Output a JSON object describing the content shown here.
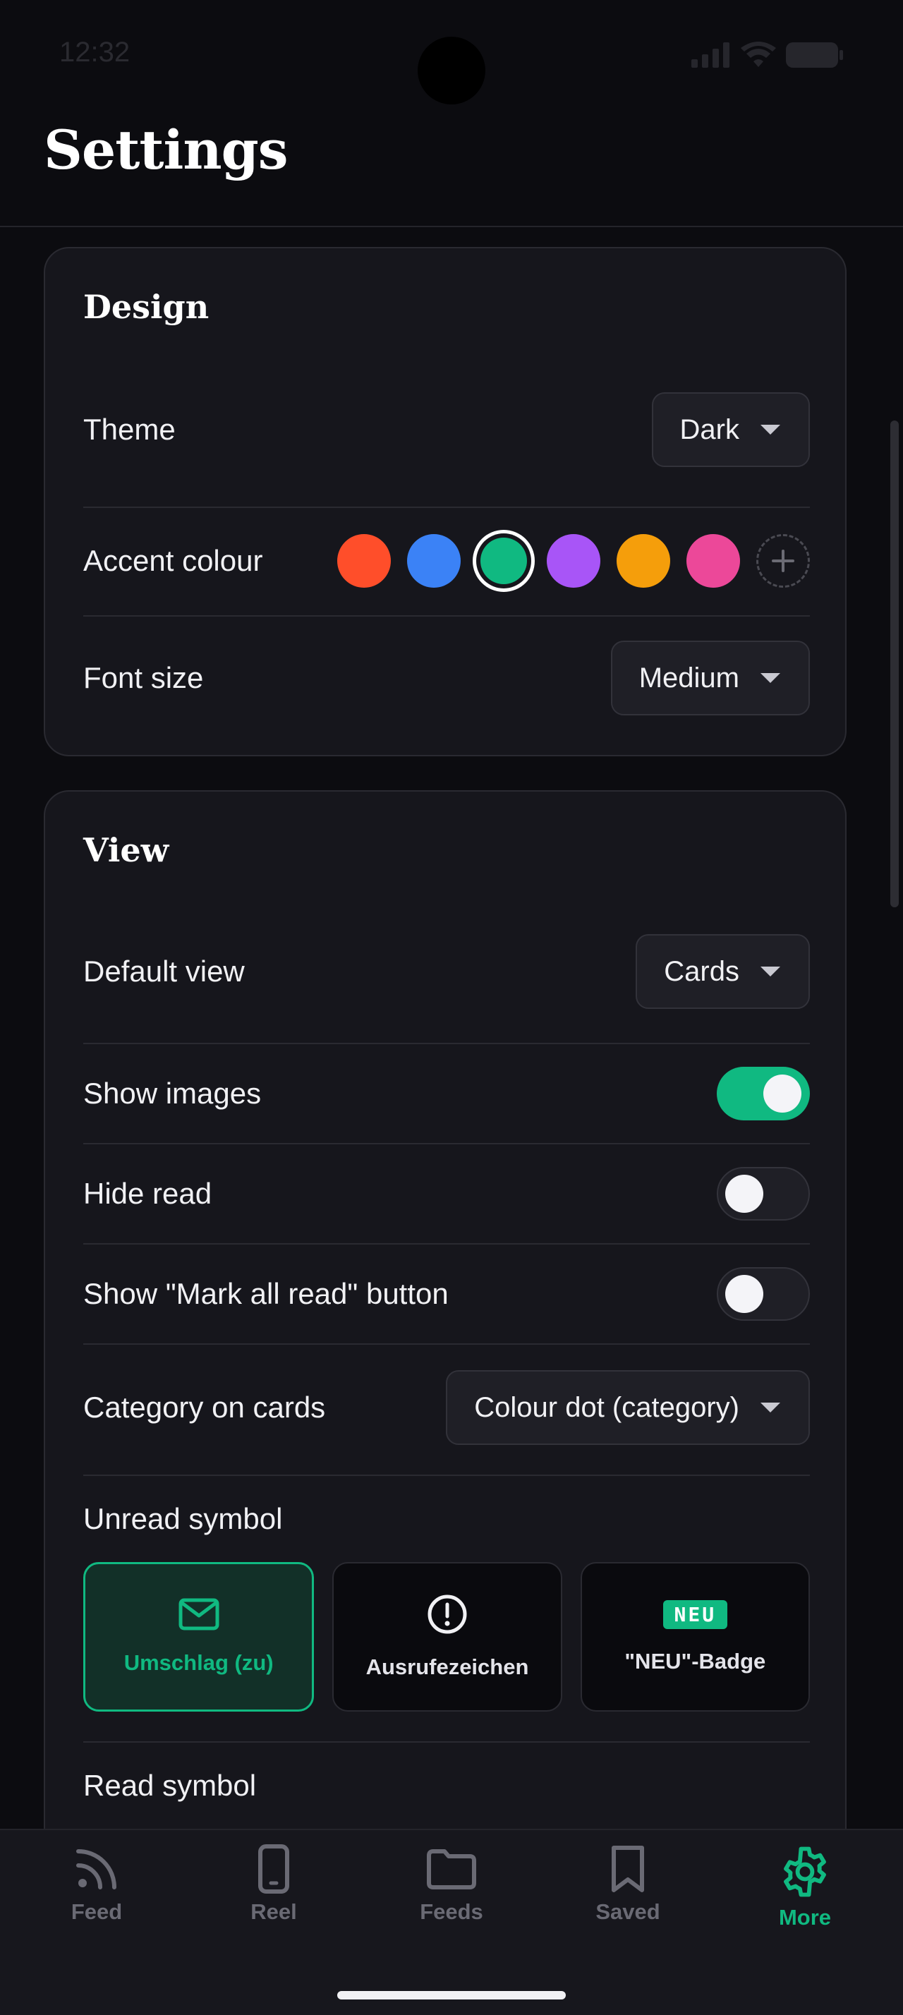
{
  "status_bar": {
    "time": "12:32"
  },
  "header": {
    "title": "Settings"
  },
  "design": {
    "title": "Design",
    "theme": {
      "label": "Theme",
      "value": "Dark"
    },
    "accent": {
      "label": "Accent colour",
      "colors": [
        "#ff4e2a",
        "#3b82f6",
        "#10b981",
        "#a855f7",
        "#f59e0b",
        "#ec4899"
      ],
      "selected": "#10b981"
    },
    "font_size": {
      "label": "Font size",
      "value": "Medium"
    }
  },
  "view": {
    "title": "View",
    "default_view": {
      "label": "Default view",
      "value": "Cards"
    },
    "show_images": {
      "label": "Show images",
      "on": true
    },
    "hide_read": {
      "label": "Hide read",
      "on": false
    },
    "mark_all_read": {
      "label": "Show \"Mark all read\" button",
      "on": false
    },
    "category_on_cards": {
      "label": "Category on cards",
      "value": "Colour dot (category)"
    },
    "unread_symbol": {
      "label": "Unread symbol",
      "options": [
        {
          "label": "Umschlag (zu)",
          "icon": "envelope-icon",
          "selected": true
        },
        {
          "label": "Ausrufezeichen",
          "icon": "exclamation-icon",
          "selected": false
        },
        {
          "label": "\"NEU\"-Badge",
          "badge": "NEU",
          "selected": false
        }
      ]
    },
    "read_symbol": {
      "label": "Read symbol"
    }
  },
  "tab_bar": {
    "tabs": [
      {
        "label": "Feed",
        "icon": "rss-icon"
      },
      {
        "label": "Reel",
        "icon": "phone-icon"
      },
      {
        "label": "Feeds",
        "icon": "folder-icon"
      },
      {
        "label": "Saved",
        "icon": "bookmark-icon"
      },
      {
        "label": "More",
        "icon": "gear-icon",
        "active": true
      }
    ]
  }
}
